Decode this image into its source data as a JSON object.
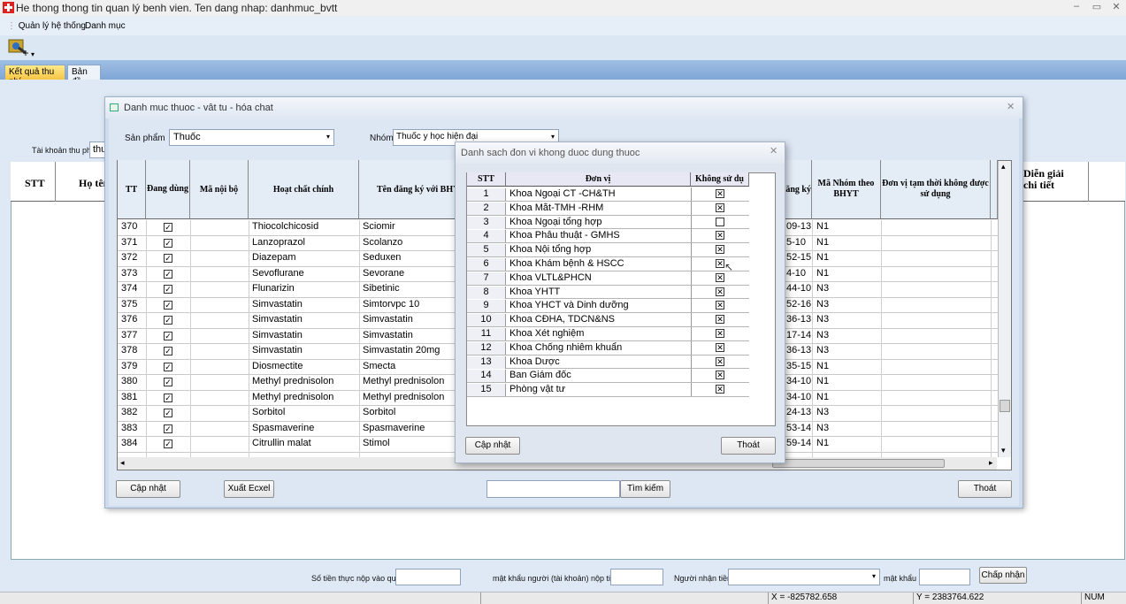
{
  "app": {
    "title": "He thong thong tin quan lý benh vien. Ten dang nhap: danhmuc_bvtt",
    "menu": [
      "Quản lý hệ thống",
      "Danh mục"
    ],
    "tabs": [
      {
        "label": "Kết quả thu phí",
        "active": true
      },
      {
        "label": "Bản đồ",
        "active": false
      }
    ],
    "tai_khoan_label": "Tài khoản thu phí",
    "tai_khoan_value": "thu",
    "bg_headers": {
      "stt": "STT",
      "ho_ten": "Họ tên",
      "dien_giai": "Diễn giải chi tiết"
    }
  },
  "dialog1": {
    "title": "Danh muc thuoc - vât tu - hóa chat",
    "san_pham_label": "Sản phẩm",
    "san_pham_value": "Thuốc",
    "nhom_label": "Nhóm",
    "nhom_value": "Thuốc y học hiện đại",
    "columns": [
      "TT",
      "Đang dùng",
      "Mã nội bộ",
      "Hoạt chất chính",
      "Tên đăng ký với BHYT",
      "Số đăng ký",
      "Mã Nhóm theo BHYT",
      "Đơn vị tạm thời không được sử dụng"
    ],
    "rows": [
      {
        "tt": "370",
        "hoat_chat": "Thiocolchicosid",
        "ten": "Sciomir",
        "so_dk": "09-13",
        "nhom": "N1"
      },
      {
        "tt": "371",
        "hoat_chat": "Lanzoprazol",
        "ten": "Scolanzo",
        "so_dk": "5-10",
        "nhom": "N1"
      },
      {
        "tt": "372",
        "hoat_chat": "Diazepam",
        "ten": "Seduxen",
        "so_dk": "52-15",
        "nhom": "N1"
      },
      {
        "tt": "373",
        "hoat_chat": "Sevoflurane",
        "ten": "Sevorane",
        "so_dk": "4-10",
        "nhom": "N1"
      },
      {
        "tt": "374",
        "hoat_chat": "Flunarizin",
        "ten": "Sibetinic",
        "so_dk": "44-10",
        "nhom": "N3"
      },
      {
        "tt": "375",
        "hoat_chat": "Simvastatin",
        "ten": "Simtorvpc 10",
        "so_dk": "52-16",
        "nhom": "N3"
      },
      {
        "tt": "376",
        "hoat_chat": "Simvastatin",
        "ten": "Simvastatin",
        "so_dk": "36-13",
        "nhom": "N3"
      },
      {
        "tt": "377",
        "hoat_chat": "Simvastatin",
        "ten": "Simvastatin",
        "so_dk": "17-14",
        "nhom": "N3"
      },
      {
        "tt": "378",
        "hoat_chat": "Simvastatin",
        "ten": "Simvastatin 20mg",
        "so_dk": "36-13",
        "nhom": "N3"
      },
      {
        "tt": "379",
        "hoat_chat": "Diosmectite",
        "ten": "Smecta",
        "so_dk": "35-15",
        "nhom": "N1"
      },
      {
        "tt": "380",
        "hoat_chat": "Methyl prednisolon",
        "ten": "Methyl prednisolon",
        "so_dk": "34-10",
        "nhom": "N1"
      },
      {
        "tt": "381",
        "hoat_chat": "Methyl prednisolon",
        "ten": "Methyl prednisolon",
        "so_dk": "34-10",
        "nhom": "N1"
      },
      {
        "tt": "382",
        "hoat_chat": "Sorbitol",
        "ten": "Sorbitol",
        "so_dk": "24-13",
        "nhom": "N3"
      },
      {
        "tt": "383",
        "hoat_chat": "Spasmaverine",
        "ten": "Spasmaverine",
        "so_dk": "53-14",
        "nhom": "N3"
      },
      {
        "tt": "384",
        "hoat_chat": "Citrullin malat",
        "ten": "Stimol",
        "so_dk": "59-14",
        "nhom": "N1"
      }
    ],
    "buttons": {
      "cap_nhat": "Cập nhật",
      "xuat_excel": "Xuất Ecxel",
      "tim_kiem": "Tìm kiếm",
      "thoat": "Thoát"
    }
  },
  "dialog2": {
    "title": "Danh sach đon vi khong duoc dung thuoc",
    "columns": {
      "stt": "STT",
      "don_vi": "Đơn vị",
      "khong_su_dung": "Không sử dụ"
    },
    "rows": [
      {
        "stt": "1",
        "don_vi": "Khoa Ngoại CT -CH&TH",
        "checked": true
      },
      {
        "stt": "2",
        "don_vi": "Khoa Mắt-TMH -RHM",
        "checked": true
      },
      {
        "stt": "3",
        "don_vi": "Khoa Ngoại tổng hợp",
        "checked": false
      },
      {
        "stt": "4",
        "don_vi": "Khoa Phẫu thuật - GMHS",
        "checked": true
      },
      {
        "stt": "5",
        "don_vi": "Khoa Nội tổng hợp",
        "checked": true
      },
      {
        "stt": "6",
        "don_vi": "Khoa Khám bệnh & HSCC",
        "checked": true
      },
      {
        "stt": "7",
        "don_vi": "Khoa VLTL&PHCN",
        "checked": true
      },
      {
        "stt": "8",
        "don_vi": "Khoa YHTT",
        "checked": true
      },
      {
        "stt": "9",
        "don_vi": "Khoa YHCT và Dinh dưỡng",
        "checked": true
      },
      {
        "stt": "10",
        "don_vi": "Khoa CĐHA, TDCN&NS",
        "checked": true
      },
      {
        "stt": "11",
        "don_vi": "Khoa Xét nghiệm",
        "checked": true
      },
      {
        "stt": "12",
        "don_vi": "Khoa Chống nhiễm khuẩn",
        "checked": true
      },
      {
        "stt": "13",
        "don_vi": "Khoa Dược",
        "checked": true
      },
      {
        "stt": "14",
        "don_vi": "Ban Giám đốc",
        "checked": true
      },
      {
        "stt": "15",
        "don_vi": "Phòng vật tư",
        "checked": true
      }
    ],
    "buttons": {
      "cap_nhat": "Cập nhật",
      "thoat": "Thoát"
    }
  },
  "bottom": {
    "so_tien_label": "Số tiền thực nộp vào quỹ",
    "mat_khau_nguoi_label": "mật khẩu người (tài khoản) nộp tiền",
    "nguoi_nhan_label": "Người nhận tiền",
    "mat_khau_label": "mật khẩu",
    "chap_nhan": "Chấp nhận"
  },
  "status": {
    "x": "X = -825782.658",
    "y": "Y = 2383764.622",
    "num": "NUM"
  }
}
